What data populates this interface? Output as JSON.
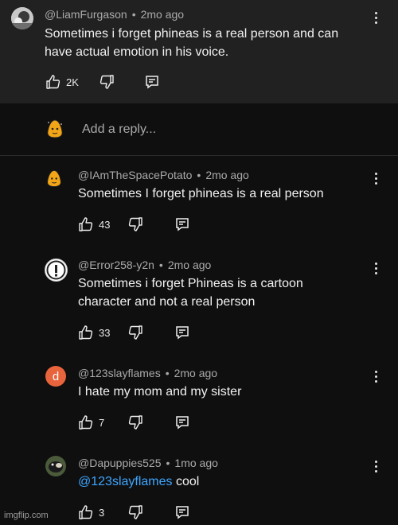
{
  "parent_comment": {
    "author": "@LiamFurgason",
    "time": "2mo ago",
    "text_line1": "Sometimes i forget phineas is a real person and can",
    "text_line2": "have actual emotion in his voice.",
    "likes": "2K"
  },
  "reply_box": {
    "placeholder": "Add a reply..."
  },
  "replies": [
    {
      "author": "@IAmTheSpacePotato",
      "time": "2mo ago",
      "line1": "Sometimes I forget phineas is a real person",
      "likes": "43"
    },
    {
      "author": "@Error258-y2n",
      "time": "2mo ago",
      "line1": "Sometimes i forget Phineas is a cartoon",
      "line2": "character and not a real person",
      "likes": "33"
    },
    {
      "author": "@123slayflames",
      "time": "2mo ago",
      "avatar_letter": "d",
      "line1": "I hate my mom and my sister",
      "likes": "7"
    },
    {
      "author": "@Dapuppies525",
      "time": "1mo ago",
      "mention": "@123slayflames",
      "line1": "cool",
      "likes": "3"
    }
  ],
  "separator": "•",
  "watermark": "imgflip.com",
  "colors": {
    "background": "#0f0f0f",
    "highlight": "#212121",
    "link": "#3ea6ff",
    "avatar_d": "#e8643c"
  }
}
